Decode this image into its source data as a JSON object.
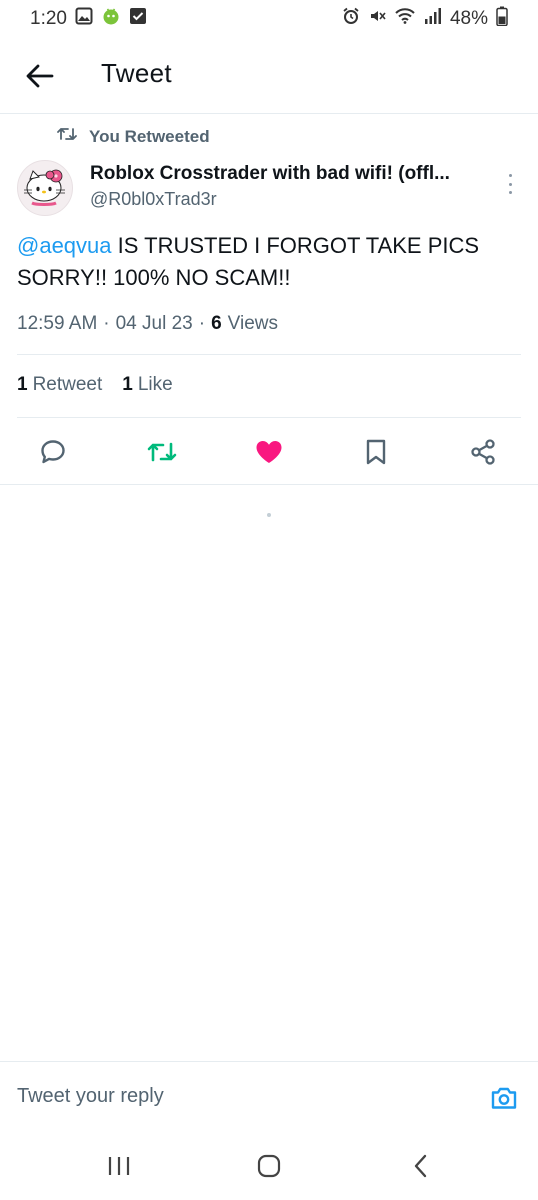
{
  "status_bar": {
    "time": "1:20",
    "battery": "48%",
    "left_icons": [
      "gallery-icon",
      "android-app-icon",
      "checkbox-icon"
    ],
    "right_icons": [
      "alarm-icon",
      "mute-icon",
      "wifi-icon",
      "signal-icon",
      "battery-icon"
    ]
  },
  "header": {
    "title": "Tweet",
    "back_icon": "arrow-left-icon"
  },
  "retweet_indicator": {
    "label": "You Retweeted",
    "icon": "retweet-icon"
  },
  "tweet": {
    "author": {
      "display_name": "Roblox Crosstrader with bad wifi! (offl...",
      "handle": "@R0bl0xTrad3r"
    },
    "mention": "@aeqvua",
    "body": " IS TRUSTED I FORGOT TAKE PICS SORRY!! 100% NO SCAM!!",
    "time": "12:59 AM",
    "separator": "·",
    "date": "04 Jul 23",
    "views_count": "6",
    "views_label": "Views",
    "retweets_count": "1",
    "retweets_label": "Retweet",
    "likes_count": "1",
    "likes_label": "Like"
  },
  "actions": [
    "reply-icon",
    "retweet-icon",
    "like-icon",
    "bookmark-icon",
    "share-icon"
  ],
  "colors": {
    "accent": "#1d9bf0",
    "retweet_active": "#00ba7c",
    "like_active": "#f91880",
    "secondary_text": "#536471"
  },
  "reply": {
    "placeholder": "Tweet your reply",
    "icon": "camera-icon"
  },
  "nav_bar": [
    "recents-icon",
    "home-icon",
    "back-icon"
  ]
}
